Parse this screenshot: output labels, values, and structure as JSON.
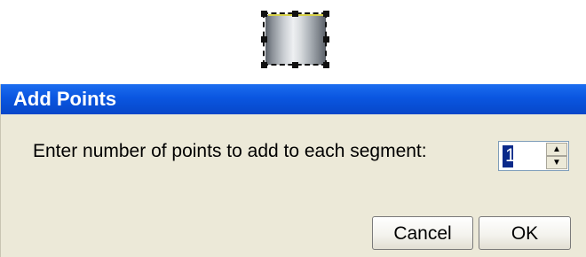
{
  "dialog": {
    "title": "Add Points",
    "prompt": "Enter number of points to add to each segment:",
    "points_value": "1",
    "cancel_label": "Cancel",
    "ok_label": "OK"
  },
  "spinner": {
    "up_icon": "arrow-up-icon",
    "down_icon": "arrow-down-icon"
  },
  "colors": {
    "titlebar": "#0a56e0",
    "dialog_bg": "#ece9d8"
  }
}
